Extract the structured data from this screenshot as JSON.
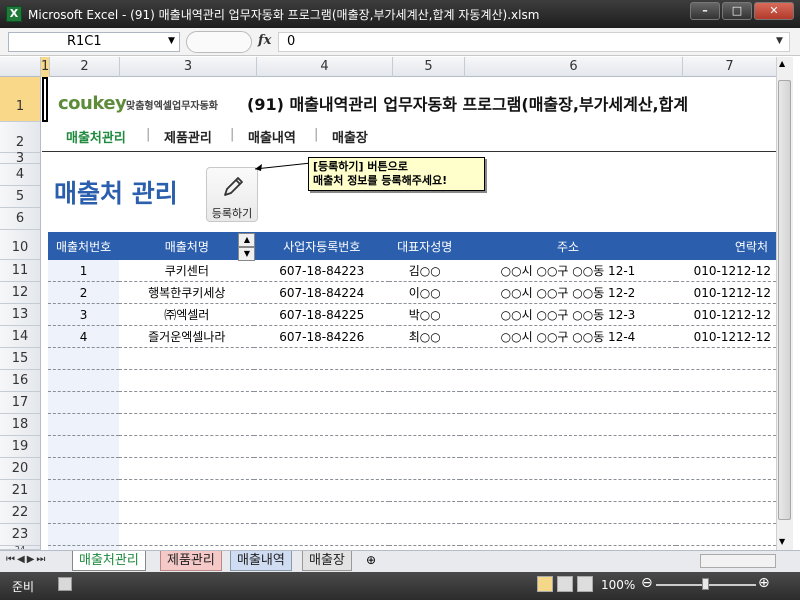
{
  "window": {
    "title": "Microsoft Excel - (91) 매출내역관리 업무자동화 프로그램(매출장,부가세계산,합계 자동계산).xlsm",
    "app_icon": "X"
  },
  "formula_bar": {
    "name_box": "R1C1",
    "formula": "0"
  },
  "columns": [
    "1",
    "2",
    "3",
    "4",
    "5",
    "6",
    "7"
  ],
  "rows": [
    "1",
    "2",
    "3",
    "4",
    "5",
    "6",
    "10",
    "11",
    "12",
    "13",
    "14",
    "15",
    "16",
    "17",
    "18",
    "19",
    "20",
    "21",
    "22",
    "23",
    "24"
  ],
  "header": {
    "logo": "coukey",
    "logo_sub": "맞춤형엑셀업무자동화",
    "title": "(91) 매출내역관리 업무자동화 프로그램(매출장,부가세계산,합계"
  },
  "nav": {
    "items": [
      "매출처관리",
      "제품관리",
      "매출내역",
      "매출장"
    ],
    "separator": "|"
  },
  "section_title": "매출처 관리",
  "register_button": {
    "label": "등록하기"
  },
  "callout": {
    "line1": "[등록하기] 버튼으로",
    "line2": "매출처 정보를 등록해주세요!"
  },
  "table": {
    "headers": [
      "매출처번호",
      "매출처명",
      "사업자등록번호",
      "대표자성명",
      "주소",
      "연락처"
    ],
    "rows": [
      [
        "1",
        "쿠키센터",
        "607-18-84223",
        "김○○",
        "○○시 ○○구 ○○동 12-1",
        "010-1212-12"
      ],
      [
        "2",
        "행복한쿠키세상",
        "607-18-84224",
        "이○○",
        "○○시 ○○구 ○○동 12-2",
        "010-1212-12"
      ],
      [
        "3",
        "㈜엑셀러",
        "607-18-84225",
        "박○○",
        "○○시 ○○구 ○○동 12-3",
        "010-1212-12"
      ],
      [
        "4",
        "즐거운엑셀나라",
        "607-18-84226",
        "최○○",
        "○○시 ○○구 ○○동 12-4",
        "010-1212-12"
      ]
    ]
  },
  "sheet_tabs": [
    "매출처관리",
    "제품관리",
    "매출내역",
    "매출장"
  ],
  "status": {
    "mode": "준비",
    "zoom": "100%"
  },
  "colors": {
    "accent": "#2b5fad",
    "nav_active": "#1f8a3e"
  }
}
